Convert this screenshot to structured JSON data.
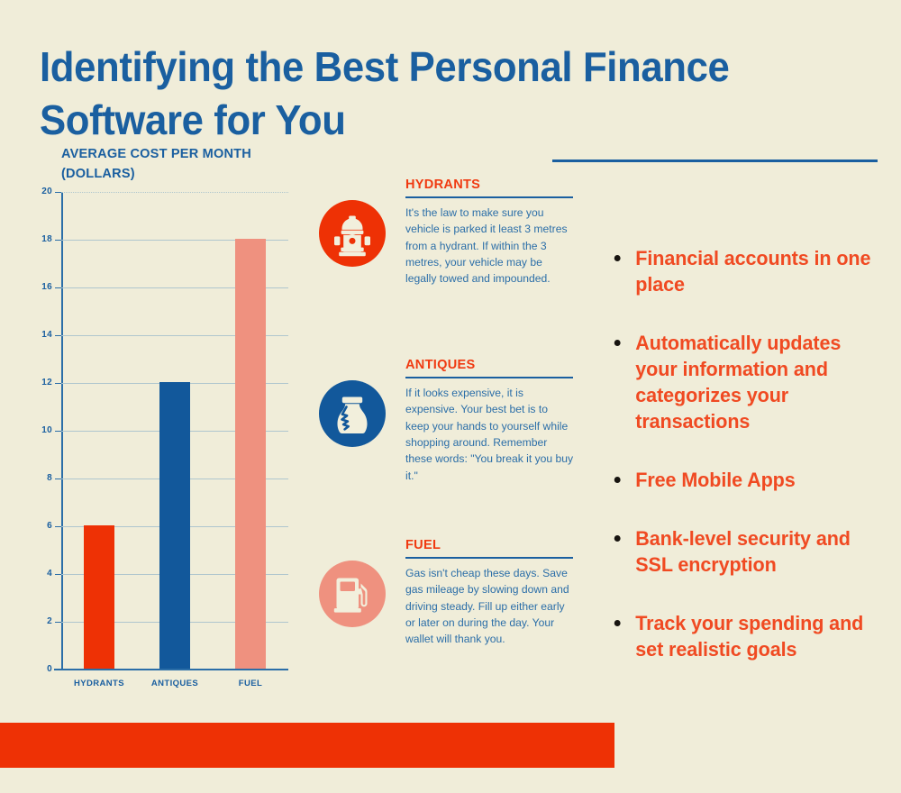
{
  "theme": {
    "background": "#F0EDD9",
    "blue": "#1A5FA0",
    "blue_text": "#2B6EA8",
    "orange": "#F03A11",
    "orange_bar": "#EE3105",
    "bullet_orange": "#F04A22",
    "salmon": "#EF917F",
    "bar_blue": "#12589B",
    "grid": "#AFC6CE",
    "bullet_dot": "#171410"
  },
  "page_title": "Identifying the Best Personal Finance Software for You",
  "chart_data": {
    "type": "bar",
    "title": "AVERAGE COST PER MONTH (DOLLARS)",
    "categories": [
      "HYDRANTS",
      "ANTIQUES",
      "FUEL"
    ],
    "values": [
      6,
      12,
      18
    ],
    "colors": [
      "#EE3105",
      "#12589B",
      "#EF917F"
    ],
    "xlabel": "",
    "ylabel": "",
    "ylim": [
      0,
      20
    ],
    "yticks": [
      0,
      2,
      4,
      6,
      8,
      10,
      12,
      14,
      16,
      18,
      20
    ],
    "ytick_labels": [
      "0",
      "2",
      "4",
      "6",
      "8",
      "10",
      "12",
      "14",
      "16",
      "18",
      "20"
    ],
    "grid": true,
    "legend": false
  },
  "sections": [
    {
      "heading": "HYDRANTS",
      "icon": "fire-hydrant-icon",
      "circle_color": "#EE3105",
      "icon_color": "#F2EFDC",
      "text": "It's the law to make sure you vehicle is parked it least 3 metres from a hydrant.  If within the 3 metres, your vehicle may be legally towed and impounded."
    },
    {
      "heading": "ANTIQUES",
      "icon": "cracked-vase-icon",
      "circle_color": "#12589B",
      "icon_color": "#F2EFDC",
      "text": "If it looks expensive, it is expensive.  Your best bet is to keep your hands to yourself while shopping around. Remember these words: \"You break it you buy it.\""
    },
    {
      "heading": "FUEL",
      "icon": "fuel-pump-icon",
      "circle_color": "#EF917F",
      "icon_color": "#F2EFDC",
      "text": "Gas isn't cheap these days. Save gas mileage by slowing down and driving steady.  Fill up either early or later on during the day. Your wallet will thank you."
    }
  ],
  "features": [
    "Financial accounts in one place",
    "Automatically updates your information  and categorizes your transactions",
    "Free Mobile Apps",
    "Bank-level security and SSL encryption",
    "Track your spending and set realistic goals"
  ]
}
